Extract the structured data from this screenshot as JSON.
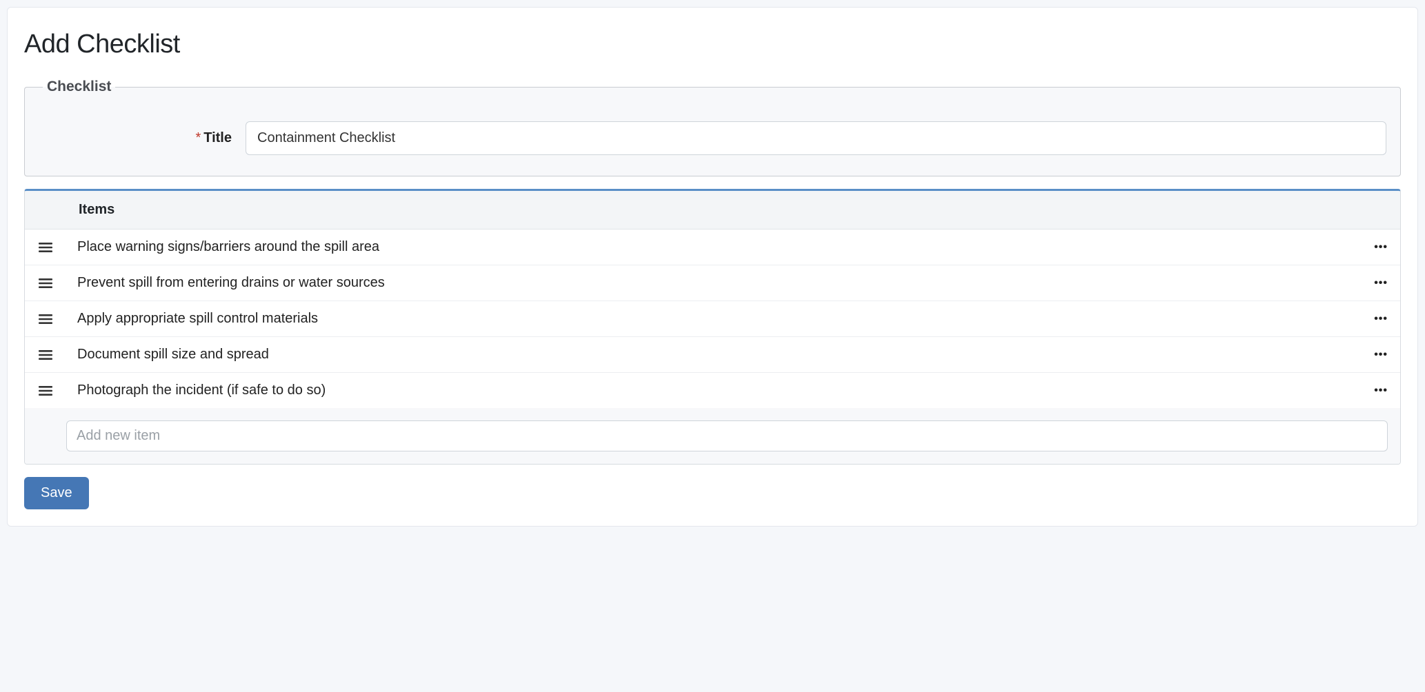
{
  "page_title": "Add Checklist",
  "fieldset": {
    "legend": "Checklist",
    "title_label": "Title",
    "title_value": "Containment Checklist"
  },
  "items_panel": {
    "header": "Items",
    "items": [
      "Place warning signs/barriers around the spill area",
      "Prevent spill from entering drains or water sources",
      "Apply appropriate spill control materials",
      "Document spill size and spread",
      "Photograph the incident (if safe to do so)"
    ],
    "add_placeholder": "Add new item"
  },
  "buttons": {
    "save": "Save"
  }
}
